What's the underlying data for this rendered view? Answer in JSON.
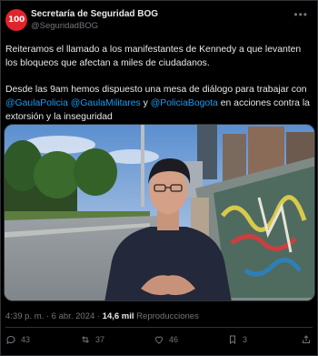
{
  "account": {
    "avatar_text": "100",
    "name": "Secretaría de Seguridad BOG",
    "handle": "@SeguridadBOG"
  },
  "tweet": {
    "paragraph1": "Reiteramos el llamado a los manifestantes de Kennedy a que levanten los bloqueos que afectan a miles de ciudadanos.",
    "paragraph2_start": "Desde las 9am hemos dispuesto una mesa de diálogo para trabajar con",
    "mention1": "@GaulaPolicia",
    "mention2": "@GaulaMilitares",
    "connector": "y",
    "mention3": "@PoliciaBogota",
    "paragraph2_end": "en acciones contra la extorsión y la inseguridad"
  },
  "meta": {
    "time_date": "4:39 p. m. · 6 abr. 2024 · ",
    "views": "14,6 mil",
    "views_label": " Reproducciones"
  },
  "actions": {
    "replies": "43",
    "reposts": "37",
    "likes": "46",
    "bookmarks": "3"
  },
  "icons": [
    "more-options-icon",
    "reply-icon",
    "repost-icon",
    "like-icon",
    "bookmark-icon",
    "share-icon"
  ],
  "colors": {
    "background": "#000000",
    "text": "#e7e9ea",
    "secondary": "#71767b",
    "link": "#1d9bf0",
    "avatar": "#e0242b"
  }
}
